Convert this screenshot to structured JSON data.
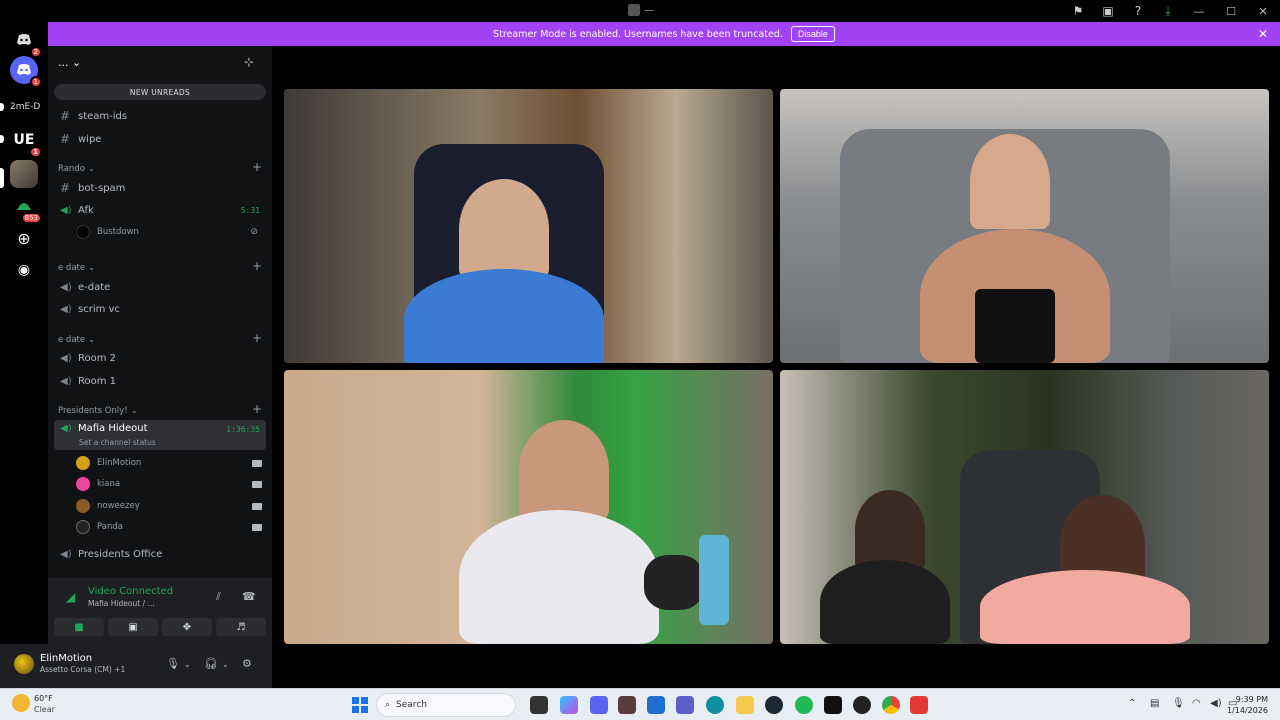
{
  "window": {
    "title_dots": "—"
  },
  "banner": {
    "message": "Streamer Mode is enabled. Usernames have been truncated.",
    "disable_label": "Disable"
  },
  "rail": {
    "dm_badge": "2",
    "discord_badge": "1",
    "server_text": "2mE-D",
    "ue_badge": "1",
    "green_badge": "853"
  },
  "server": {
    "name": "...",
    "new_unreads": "NEW UNREADS"
  },
  "channels": {
    "steam_ids": "steam-ids",
    "wipe": "wipe",
    "cat_rando": "Rando",
    "bot_spam": "bot-spam",
    "afk": "Afk",
    "afk_time": "5:31",
    "bustdown": "Bustdown",
    "cat_edate1": "e date",
    "e_date": "e-date",
    "scrim_vc": "scrim vc",
    "cat_edate2": "e date",
    "room2": "Room 2",
    "room1": "Room 1",
    "cat_presidents": "Presidents Only!",
    "mafia": "Mafia Hideout",
    "mafia_time": "1:36:35",
    "mafia_status": "Set a channel status",
    "presidents_office": "Presidents Office"
  },
  "members": [
    {
      "name": "ElinMotion",
      "color": "#d4a017"
    },
    {
      "name": "kiana",
      "color": "#eb459e"
    },
    {
      "name": "noweezey",
      "color": "#8b5a2b"
    },
    {
      "name": "Panda",
      "color": "#222222"
    }
  ],
  "voice": {
    "status": "Video Connected",
    "channel": "Mafia Hideout / ..."
  },
  "user": {
    "name": "ElinMotion",
    "activity": "Assetto Corsa (CM) +1"
  },
  "taskbar": {
    "temp": "60°F",
    "condition": "Clear",
    "search": "Search",
    "time": "9:39 PM",
    "date": "1/14/2026"
  },
  "colors": {
    "banner": "#a242f5",
    "connected_green": "#23a559"
  }
}
